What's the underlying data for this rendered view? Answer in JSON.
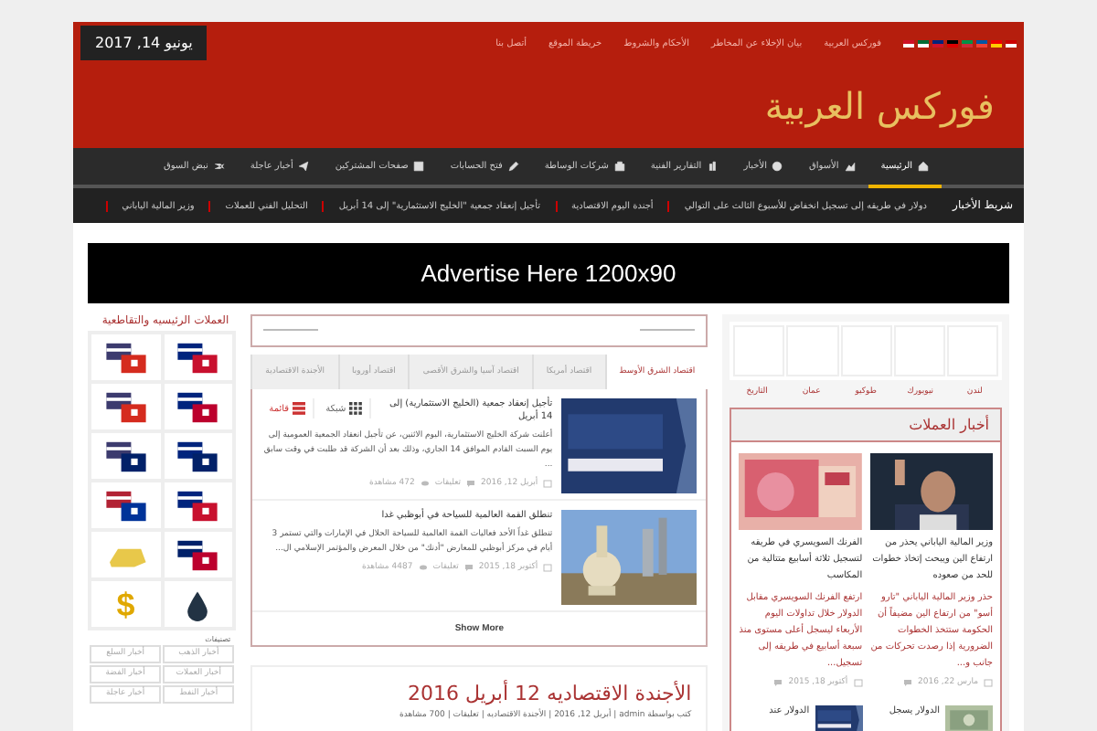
{
  "top_bar": {
    "links": [
      "فوركس العربية",
      "بيان الإخلاء عن المخاطر",
      "الأحكام والشروط",
      "خريطة الموقع",
      "أتصل بنا"
    ],
    "date": "يونيو 14, 2017"
  },
  "logo": "فوركس العربية",
  "nav": [
    {
      "label": "الرئيسية",
      "selected": true
    },
    {
      "label": "الأسواق",
      "selected": false
    },
    {
      "label": "الأخبار",
      "selected": false
    },
    {
      "label": "التقارير الفنية",
      "selected": false
    },
    {
      "label": "شركات الوساطة",
      "selected": false
    },
    {
      "label": "فتح الحسابات",
      "selected": false
    },
    {
      "label": "صفحات المشتركين",
      "selected": false
    },
    {
      "label": "أخبار عاجلة",
      "selected": false
    },
    {
      "label": "نبض السوق",
      "selected": false
    }
  ],
  "ticker": {
    "label": "شريط الأخبار",
    "items": [
      "دولار في طريقه إلى تسجيل انخفاض للأسبوع الثالث على التوالي",
      "أجندة اليوم الاقتصادية",
      "تأجيل إنعقاد جمعية \"الخليج الاستثمارية\" إلى 14 أبريل",
      "التحليل الفني للعملات",
      "وزير المالية الياباني"
    ]
  },
  "ad": "Advertise Here 1200x90",
  "clocks": {
    "cities": [
      "لندن",
      "نيويورك",
      "طوكيو",
      "عمان",
      "التاريخ"
    ]
  },
  "currency_news": {
    "title": "أخبار العملات",
    "articles": [
      {
        "title": "وزير المالية الياباني يحذر من ارتفاع الين ويبحث إتخاذ خطوات للحد من صعوده",
        "excerpt": "حذر وزير المالية الياباني \"تارو أسو\" من ارتفاع الين مضيفاً أن الحكومة ستتخذ الخطوات الضرورية إذا رصدت تحركات من جانب و...",
        "date": "مارس 22, 2016"
      },
      {
        "title": "الفرنك السويسري في طريقه لتسجيل ثلاثة أسابيع متتالية من المكاسب",
        "excerpt": "ارتفع الفرنك السويسري مقابل الدولار خلال تداولات اليوم الأربعاء ليسجل أعلى مستوى منذ سبعة أسابيع في طريقه إلى تسجيل...",
        "date": "أكتوبر 18, 2015"
      }
    ],
    "more": [
      "الدولار يسجل",
      "الدولار عند"
    ]
  },
  "tabs": [
    {
      "label": "اقتصاد الشرق الأوسط",
      "selected": true
    },
    {
      "label": "اقتصاد أمريكا",
      "selected": false
    },
    {
      "label": "اقتصاد آسيا والشرق الأقصى",
      "selected": false
    },
    {
      "label": "اقتصاد أوروبا",
      "selected": false
    },
    {
      "label": "الأجندة الاقتصادية",
      "selected": false
    }
  ],
  "views": [
    {
      "label": "شبكة",
      "selected": false
    },
    {
      "label": "قائمة",
      "selected": true
    }
  ],
  "articles": [
    {
      "title": "تأجيل إنعقاد جمعية (الخليج الاستثمارية) إلى 14 أبريل",
      "excerpt": "أعلنت شركة الخليج الاستثمارية، اليوم الاثنين، عن تأجيل انعقاد الجمعية العمومية إلى يوم السبت القادم الموافق 14 الجاري، وذلك بعد أن الشركة قد طلبت في وقت سابق ...",
      "date": "أبريل 12, 2016",
      "comments": "تعليقات",
      "views": "472 مشاهدة"
    },
    {
      "title": "تنطلق القمة العالمية للسياحة في أبوظبي غدا",
      "excerpt": "تنطلق غداً الأحد فعاليات القمة العالمية للسياحة الحلال في الإمارات والتي تستمر 3 أيام في مركز أبوظبي للمعارض \"أدنك\" من خلال المعرض والمؤتمر الإسلامي ال...",
      "date": "أكتوبر 18, 2015",
      "comments": "تعليقات",
      "views": "4487 مشاهدة"
    }
  ],
  "show_more": "Show More",
  "post": {
    "title": "الأجندة الاقتصاديه 12 أبريل 2016",
    "meta": "كتب بواسطة admin | أبريل 12, 2016 | الأجندة الاقتصاديه | تعليقات | 700 مشاهدة"
  },
  "currencies": {
    "title": "العملات الرئيسيه والتقاطعية",
    "items": [
      {
        "kind": "pair"
      },
      {
        "kind": "pair"
      },
      {
        "kind": "pair"
      },
      {
        "kind": "pair"
      },
      {
        "kind": "pair"
      },
      {
        "kind": "pair"
      },
      {
        "kind": "pair"
      },
      {
        "kind": "pair"
      },
      {
        "kind": "pair"
      },
      {
        "kind": "gold"
      },
      {
        "kind": "oil"
      },
      {
        "kind": "symbol",
        "symbol": "$"
      }
    ]
  },
  "categories": {
    "title": "تصنيفات",
    "tags": [
      "أخبار الذهب",
      "أخبار السلع",
      "أخبار العملات",
      "أخبار الفضة",
      "أخبار النفط",
      "أخبار عاجلة"
    ]
  }
}
